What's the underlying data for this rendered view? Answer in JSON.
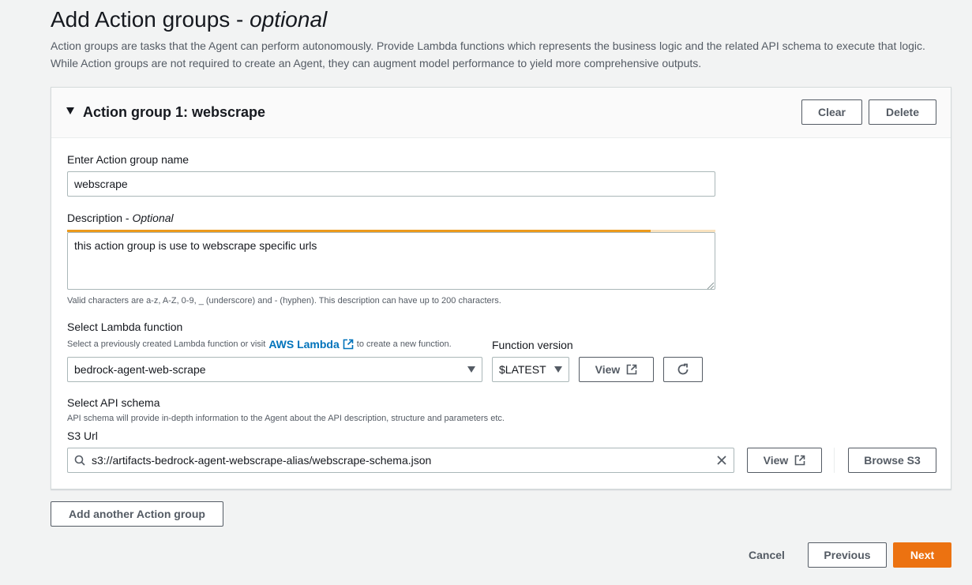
{
  "page": {
    "title": "Add Action groups -",
    "title_optional": "optional",
    "description_line1": "Action groups are tasks that the Agent can perform autonomously. Provide Lambda functions which represents the business logic and the related API schema to execute that logic.",
    "description_line2": "While Action groups are not required to create an Agent, they can augment model performance to yield more comprehensive outputs."
  },
  "action_group": {
    "title": "Action group 1: webscrape",
    "clear_label": "Clear",
    "delete_label": "Delete",
    "name_label": "Enter Action group name",
    "name_value": "webscrape",
    "description_label": "Description -",
    "description_optional": "Optional",
    "description_value": "this action group is use to webscrape specific urls",
    "description_progress": 0.9,
    "description_hint": "Valid characters are a-z, A-Z, 0-9, _ (underscore) and - (hyphen). This description can have up to 200 characters.",
    "lambda_label": "Select Lambda function",
    "lambda_hint_before": "Select a previously created Lambda function or visit",
    "lambda_hint_link": "AWS Lambda",
    "lambda_hint_after": "to create a new function.",
    "lambda_value": "bedrock-agent-web-scrape",
    "version_label": "Function version",
    "version_value": "$LATEST",
    "view_label": "View",
    "api_label": "Select API schema",
    "api_hint": "API schema will provide in-depth information to the Agent about the API description, structure and parameters etc.",
    "s3_label": "S3 Url",
    "s3_value": "s3://artifacts-bedrock-agent-webscrape-alias/webscrape-schema.json",
    "s3_view_label": "View",
    "browse_label": "Browse S3"
  },
  "footer": {
    "add_another_label": "Add another Action group",
    "cancel_label": "Cancel",
    "previous_label": "Previous",
    "next_label": "Next"
  },
  "colors": {
    "primary": "#ec7211",
    "link": "#0073bb",
    "progress": "#ec9a1c"
  }
}
